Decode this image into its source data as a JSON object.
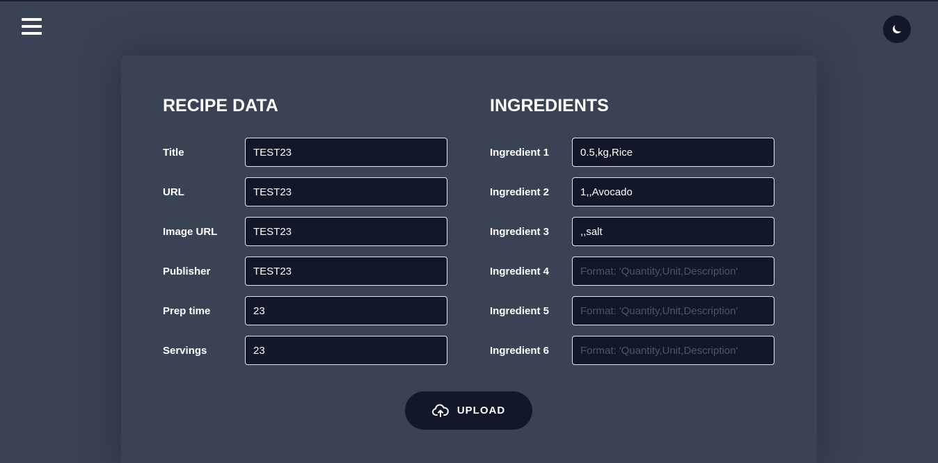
{
  "header": {
    "menu_icon": "hamburger-menu-icon",
    "theme_icon": "moon-icon"
  },
  "recipe": {
    "heading": "RECIPE DATA",
    "fields": [
      {
        "label": "Title",
        "value": "TEST23",
        "placeholder": ""
      },
      {
        "label": "URL",
        "value": "TEST23",
        "placeholder": ""
      },
      {
        "label": "Image URL",
        "value": "TEST23",
        "placeholder": ""
      },
      {
        "label": "Publisher",
        "value": "TEST23",
        "placeholder": ""
      },
      {
        "label": "Prep time",
        "value": "23",
        "placeholder": ""
      },
      {
        "label": "Servings",
        "value": "23",
        "placeholder": ""
      }
    ]
  },
  "ingredients": {
    "heading": "INGREDIENTS",
    "fields": [
      {
        "label": "Ingredient 1",
        "value": "0.5,kg,Rice",
        "placeholder": "Format: 'Quantity,Unit,Description'"
      },
      {
        "label": "Ingredient 2",
        "value": "1,,Avocado",
        "placeholder": "Format: 'Quantity,Unit,Description'"
      },
      {
        "label": "Ingredient 3",
        "value": ",,salt",
        "placeholder": "Format: 'Quantity,Unit,Description'"
      },
      {
        "label": "Ingredient 4",
        "value": "",
        "placeholder": "Format: 'Quantity,Unit,Description'"
      },
      {
        "label": "Ingredient 5",
        "value": "",
        "placeholder": "Format: 'Quantity,Unit,Description'"
      },
      {
        "label": "Ingredient 6",
        "value": "",
        "placeholder": "Format: 'Quantity,Unit,Description'"
      }
    ]
  },
  "upload": {
    "label": "UPLOAD",
    "icon": "cloud-upload-icon"
  },
  "colors": {
    "background": "#3a4354",
    "input_background": "#121829",
    "text": "#ffffff",
    "placeholder": "#4b5566"
  }
}
